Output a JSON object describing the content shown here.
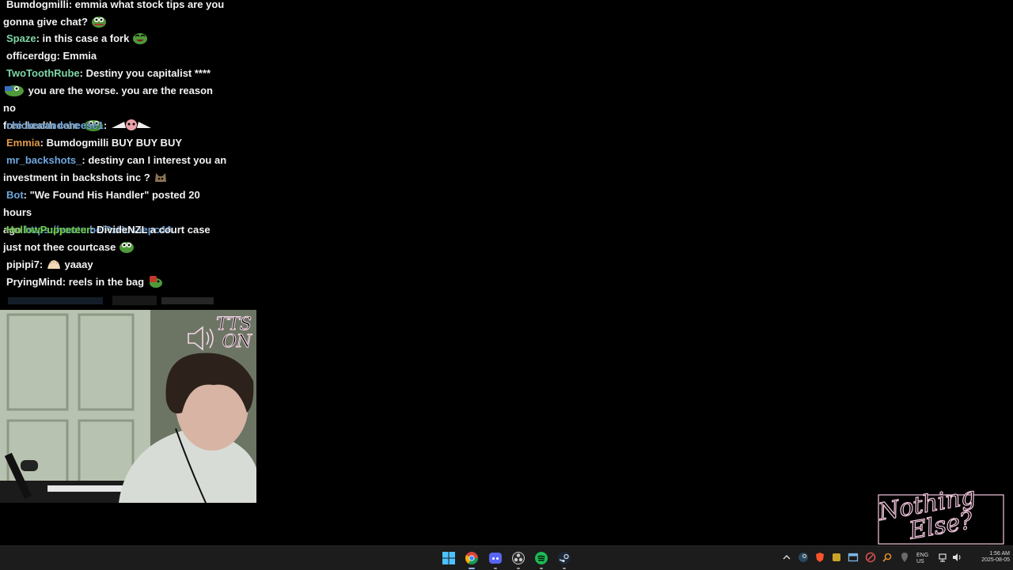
{
  "chat": {
    "messages": [
      {
        "user": "Bumdogmilli",
        "color": "#f2f2f2",
        "text_line1": ": emmia what stock tips are you",
        "text_line2": "gonna give chat?",
        "emote": "pepe-emote"
      },
      {
        "user": "Spaze",
        "color": "#7fd6a8",
        "text": ": in this case a fork",
        "emote": "pepe-laugh-emote"
      },
      {
        "user": "officerdgg",
        "color": "#f2f2f2",
        "text": ": Emmia"
      },
      {
        "user": "TwoToothRube",
        "color": "#7fd6a8",
        "text_line1": ": Destiny you capitalist ****",
        "text_line2": "you are the worse. you are the reason no",
        "text_line3": "free health care"
      },
      {
        "user": "chickenandcheese1",
        "color": "#6ea8e0",
        "text": ":",
        "emote": "winged-emote"
      },
      {
        "user": "Emmia",
        "color": "#e09a4a",
        "text": ": Bumdogmilli BUY BUY BUY"
      },
      {
        "user": "mr_backshots_",
        "color": "#6ea8e0",
        "text_line1": ": destiny can I interest you an",
        "text_line2": "investment in backshots inc ?",
        "emote": "cat-emote"
      },
      {
        "user": "Bot",
        "color": "#6ea8e0",
        "text_line1": ": \"We Found His Handler\" posted 20 hours",
        "text_line2": "ago",
        "link": "https://youtu.be/PxHosaepc4A"
      },
      {
        "user": "HollowPuppeteer",
        "color": "#6fd04a",
        "text_line1": ": DivideNZL a court case",
        "text_line2": "just not thee courtcase",
        "emote": "pepe-emote"
      },
      {
        "user": "pipipi7",
        "color": "#f2f2f2",
        "text": ": ",
        "text_after": "yaaay",
        "emote": "hand-emote"
      },
      {
        "user": "PryingMind",
        "color": "#f2f2f2",
        "text": ": reels in the bag",
        "emote": "pepe-bag-emote"
      }
    ]
  },
  "overlay": {
    "tts_line1": "TTS",
    "tts_line2": "ON",
    "logo_line1": "Nothing",
    "logo_line2": "Else?"
  },
  "taskbar": {
    "lang_top": "ENG",
    "lang_bottom": "US",
    "time": "1:56 AM",
    "date": "2025-08-05",
    "icons": [
      "start-icon",
      "chrome-icon",
      "discord-icon",
      "obs-icon",
      "spotify-icon",
      "steam-icon"
    ]
  }
}
